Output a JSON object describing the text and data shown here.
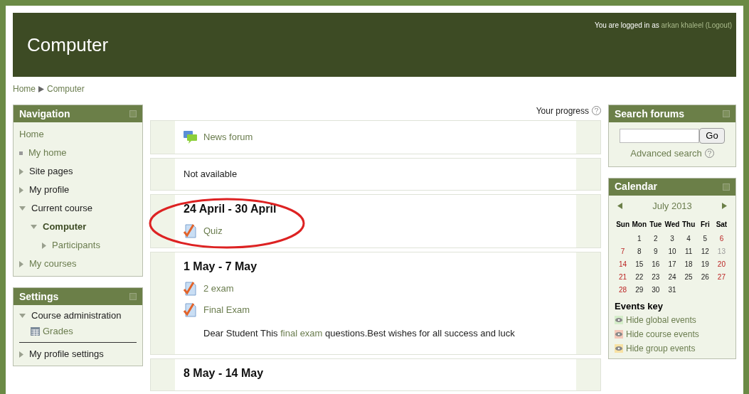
{
  "header": {
    "title": "Computer",
    "login_prefix": "You are logged in as",
    "user": "arkan khaleel",
    "logout": "(Logout)"
  },
  "breadcrumb": [
    "Home",
    "Computer"
  ],
  "navigation": {
    "title": "Navigation",
    "items": [
      {
        "label": "Home",
        "kind": "root",
        "selected": false
      },
      {
        "label": "My home",
        "kind": "leaf",
        "selected": false
      },
      {
        "label": "Site pages",
        "kind": "branch",
        "expanded": false,
        "selected": false
      },
      {
        "label": "My profile",
        "kind": "branch",
        "expanded": false,
        "selected": false
      },
      {
        "label": "Current course",
        "kind": "branch",
        "expanded": true,
        "selected": false,
        "children": [
          {
            "label": "Computer",
            "kind": "branch",
            "expanded": true,
            "selected": true,
            "children": [
              {
                "label": "Participants",
                "kind": "branch",
                "expanded": false,
                "selected": false,
                "link": true
              }
            ]
          }
        ]
      },
      {
        "label": "My courses",
        "kind": "branch",
        "expanded": false,
        "selected": false,
        "link": true
      }
    ]
  },
  "settings": {
    "title": "Settings",
    "admin": {
      "label": "Course administration",
      "expanded": true,
      "children": [
        "Grades"
      ]
    },
    "profile": {
      "label": "My profile settings",
      "expanded": false
    }
  },
  "progress": "Your progress",
  "sections": [
    {
      "activities": [
        {
          "kind": "forum",
          "label": "News forum"
        }
      ]
    },
    {
      "text": "Not available"
    },
    {
      "title": "24 April - 30 April",
      "circled": true,
      "activities": [
        {
          "kind": "quiz",
          "label": "Quiz"
        }
      ]
    },
    {
      "title": "1 May - 7 May",
      "circled": false,
      "activities": [
        {
          "kind": "quiz",
          "label": "2 exam"
        },
        {
          "kind": "quiz",
          "label": "Final Exam"
        }
      ],
      "summary": {
        "before": "Dear Student This",
        "link": "final exam",
        "after": "questions.Best wishes for all success and luck"
      }
    },
    {
      "title": "8 May - 14 May",
      "circled": false
    }
  ],
  "search_forums": {
    "title": "Search forums",
    "button": "Go",
    "advanced": "Advanced search"
  },
  "calendar": {
    "title": "Calendar",
    "month": "July 2013",
    "weekdays": [
      "Sun",
      "Mon",
      "Tue",
      "Wed",
      "Thu",
      "Fri",
      "Sat"
    ],
    "weeks": [
      [
        {
          "d": "1",
          "kind": "plain"
        },
        {
          "d": "2",
          "kind": "plain"
        },
        {
          "d": "3",
          "kind": "plain"
        },
        {
          "d": "4",
          "kind": "plain"
        },
        {
          "d": "5",
          "kind": "plain"
        },
        {
          "d": "6",
          "kind": "weekend"
        }
      ],
      [
        {
          "d": "7",
          "kind": "weekend"
        },
        {
          "d": "8",
          "kind": "plain"
        },
        {
          "d": "9",
          "kind": "plain"
        },
        {
          "d": "10",
          "kind": "plain"
        },
        {
          "d": "11",
          "kind": "plain"
        },
        {
          "d": "12",
          "kind": "plain"
        },
        {
          "d": "13",
          "kind": "today"
        }
      ],
      [
        {
          "d": "14",
          "kind": "weekend"
        },
        {
          "d": "15",
          "kind": "plain"
        },
        {
          "d": "16",
          "kind": "plain"
        },
        {
          "d": "17",
          "kind": "plain"
        },
        {
          "d": "18",
          "kind": "plain"
        },
        {
          "d": "19",
          "kind": "plain"
        },
        {
          "d": "20",
          "kind": "weekend"
        }
      ],
      [
        {
          "d": "21",
          "kind": "weekend"
        },
        {
          "d": "22",
          "kind": "plain"
        },
        {
          "d": "23",
          "kind": "plain"
        },
        {
          "d": "24",
          "kind": "plain"
        },
        {
          "d": "25",
          "kind": "plain"
        },
        {
          "d": "26",
          "kind": "plain"
        },
        {
          "d": "27",
          "kind": "weekend"
        }
      ],
      [
        {
          "d": "28",
          "kind": "weekend"
        },
        {
          "d": "29",
          "kind": "plain"
        },
        {
          "d": "30",
          "kind": "plain"
        },
        {
          "d": "31",
          "kind": "plain"
        }
      ]
    ],
    "events_title": "Events key",
    "events": [
      {
        "label": "Hide global events",
        "color": "#d4edc9"
      },
      {
        "label": "Hide course events",
        "color": "#f4c7b8"
      },
      {
        "label": "Hide group events",
        "color": "#f8e2a4"
      }
    ]
  }
}
